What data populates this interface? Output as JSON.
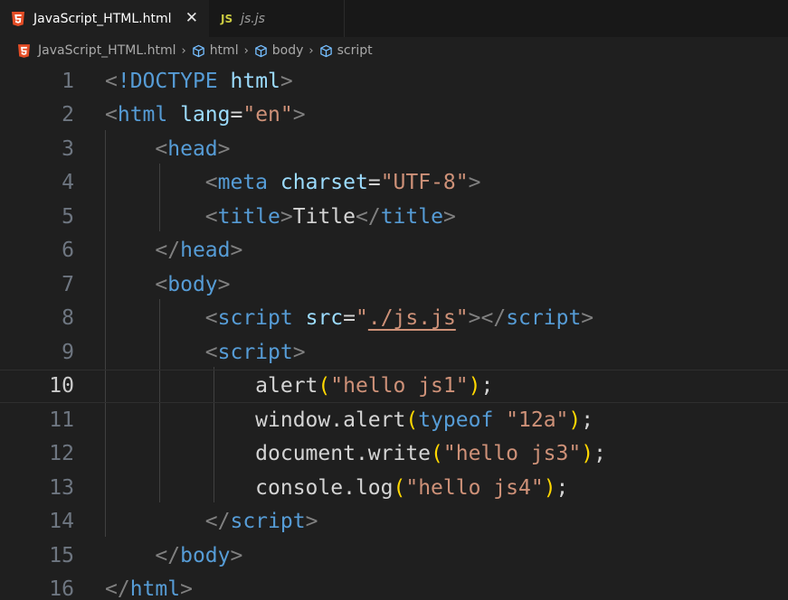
{
  "tabs": [
    {
      "label": "JavaScript_HTML.html",
      "icon": "html5-icon",
      "active": true
    },
    {
      "label": "js.js",
      "icon": "js-icon",
      "icon_text": "JS",
      "active": false
    }
  ],
  "close_glyph": "✕",
  "breadcrumb": {
    "file": "JavaScript_HTML.html",
    "items": [
      "html",
      "body",
      "script"
    ],
    "separator": "›"
  },
  "editor": {
    "current_line": 10,
    "line_numbers": [
      "1",
      "2",
      "3",
      "4",
      "5",
      "6",
      "7",
      "8",
      "9",
      "10",
      "11",
      "12",
      "13",
      "14",
      "15",
      "16"
    ],
    "lines": [
      [
        [
          "punct",
          "<"
        ],
        [
          "tag",
          "!DOCTYPE"
        ],
        [
          "text",
          " "
        ],
        [
          "attr",
          "html"
        ],
        [
          "punct",
          ">"
        ]
      ],
      [
        [
          "punct",
          "<"
        ],
        [
          "tag",
          "html"
        ],
        [
          "text",
          " "
        ],
        [
          "attr",
          "lang"
        ],
        [
          "text",
          "="
        ],
        [
          "str",
          "\"en\""
        ],
        [
          "punct",
          ">"
        ]
      ],
      [
        [
          "text",
          "    "
        ],
        [
          "punct",
          "<"
        ],
        [
          "tag",
          "head"
        ],
        [
          "punct",
          ">"
        ]
      ],
      [
        [
          "text",
          "        "
        ],
        [
          "punct",
          "<"
        ],
        [
          "tag",
          "meta"
        ],
        [
          "text",
          " "
        ],
        [
          "attr",
          "charset"
        ],
        [
          "text",
          "="
        ],
        [
          "str",
          "\"UTF-8\""
        ],
        [
          "punct",
          ">"
        ]
      ],
      [
        [
          "text",
          "        "
        ],
        [
          "punct",
          "<"
        ],
        [
          "tag",
          "title"
        ],
        [
          "punct",
          ">"
        ],
        [
          "text",
          "Title"
        ],
        [
          "punct",
          "</"
        ],
        [
          "tag",
          "title"
        ],
        [
          "punct",
          ">"
        ]
      ],
      [
        [
          "text",
          "    "
        ],
        [
          "punct",
          "</"
        ],
        [
          "tag",
          "head"
        ],
        [
          "punct",
          ">"
        ]
      ],
      [
        [
          "text",
          "    "
        ],
        [
          "punct",
          "<"
        ],
        [
          "tag",
          "body"
        ],
        [
          "punct",
          ">"
        ]
      ],
      [
        [
          "text",
          "        "
        ],
        [
          "punct",
          "<"
        ],
        [
          "tag",
          "script"
        ],
        [
          "text",
          " "
        ],
        [
          "attr",
          "src"
        ],
        [
          "text",
          "="
        ],
        [
          "str",
          "\""
        ],
        [
          "strlink",
          "./js.js"
        ],
        [
          "str",
          "\""
        ],
        [
          "punct",
          "></"
        ],
        [
          "tag",
          "script"
        ],
        [
          "punct",
          ">"
        ]
      ],
      [
        [
          "text",
          "        "
        ],
        [
          "punct",
          "<"
        ],
        [
          "tag",
          "script"
        ],
        [
          "punct",
          ">"
        ]
      ],
      [
        [
          "text",
          "            alert"
        ],
        [
          "br1",
          "("
        ],
        [
          "str",
          "\"hello js1\""
        ],
        [
          "br1",
          ")"
        ],
        [
          "text",
          ";"
        ]
      ],
      [
        [
          "text",
          "            window.alert"
        ],
        [
          "br1",
          "("
        ],
        [
          "kw",
          "typeof"
        ],
        [
          "text",
          " "
        ],
        [
          "str",
          "\"12a\""
        ],
        [
          "br1",
          ")"
        ],
        [
          "text",
          ";"
        ]
      ],
      [
        [
          "text",
          "            document.write"
        ],
        [
          "br1",
          "("
        ],
        [
          "str",
          "\"hello js3\""
        ],
        [
          "br1",
          ")"
        ],
        [
          "text",
          ";"
        ]
      ],
      [
        [
          "text",
          "            console.log"
        ],
        [
          "br1",
          "("
        ],
        [
          "str",
          "\"hello js4\""
        ],
        [
          "br1",
          ")"
        ],
        [
          "text",
          ";"
        ]
      ],
      [
        [
          "text",
          "        "
        ],
        [
          "punct",
          "</"
        ],
        [
          "tag",
          "script"
        ],
        [
          "punct",
          ">"
        ]
      ],
      [
        [
          "text",
          "    "
        ],
        [
          "punct",
          "</"
        ],
        [
          "tag",
          "body"
        ],
        [
          "punct",
          ">"
        ]
      ],
      [
        [
          "punct",
          "</"
        ],
        [
          "tag",
          "html"
        ],
        [
          "punct",
          ">"
        ]
      ]
    ]
  },
  "colors": {
    "background": "#1f1f1f",
    "tab_bar": "#181818",
    "tag": "#569cd6",
    "attribute": "#9cdcfe",
    "string": "#ce9178",
    "bracket": "#ffd700",
    "punctuation": "#808080",
    "html5_icon": "#e44d26",
    "js_icon": "#cbcb41"
  }
}
